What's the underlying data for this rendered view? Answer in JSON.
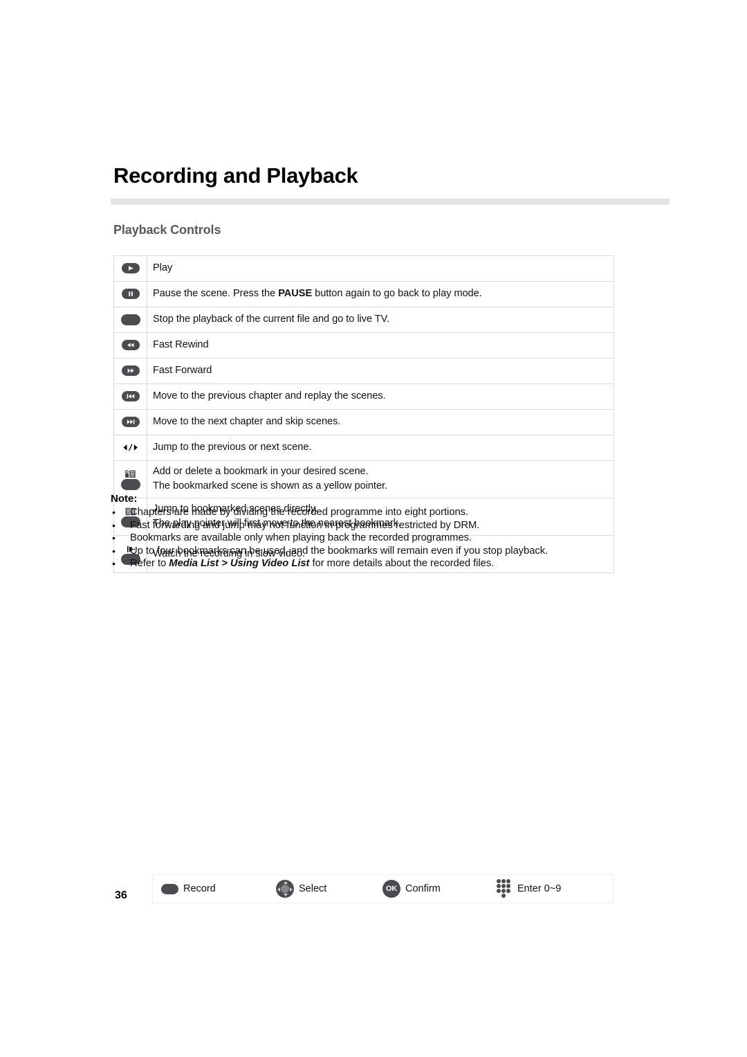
{
  "document": {
    "title": "Recording and Playback",
    "section_heading": "Playback Controls",
    "page_number": "36"
  },
  "table": {
    "rows": [
      {
        "icon": "play-button-icon",
        "lines": [
          "Play"
        ]
      },
      {
        "icon": "pause-button-icon",
        "lines": [
          "Pause the scene. Press the PAUSE button again to go back to play mode."
        ],
        "bold_token": "PAUSE"
      },
      {
        "icon": "stop-button-icon",
        "lines": [
          "Stop the playback of the current file and go to live TV."
        ]
      },
      {
        "icon": "fast-rewind-button-icon",
        "lines": [
          "Fast Rewind"
        ]
      },
      {
        "icon": "fast-forward-button-icon",
        "lines": [
          "Fast Forward"
        ]
      },
      {
        "icon": "previous-chapter-button-icon",
        "lines": [
          "Move to the previous chapter and replay the scenes."
        ]
      },
      {
        "icon": "next-chapter-button-icon",
        "lines": [
          "Move to the next chapter and skip scenes."
        ]
      },
      {
        "icon": "left-right-arrows-icon",
        "lines": [
          "Jump to the previous or next scene."
        ]
      },
      {
        "icon": "add-bookmark-button-icon",
        "lines": [
          "Add or delete a bookmark in your desired scene.",
          "The bookmarked scene is shown as a yellow pointer."
        ]
      },
      {
        "icon": "bookmark-list-button-icon",
        "lines": [
          "Jump to bookmarked scenes directly.",
          "The play pointer will first move to the nearest bookmark."
        ]
      },
      {
        "icon": "slow-motion-button-icon",
        "lines": [
          "Watch the recording in slow video."
        ]
      }
    ]
  },
  "note": {
    "title": "Note:",
    "bullet": "•",
    "items": [
      {
        "text": "Chapters are made by dividing the recorded programme into eight portions."
      },
      {
        "text": "Fast forwarding and jump may not function in programmes restricted by DRM."
      },
      {
        "text": "Bookmarks are available only when playing back the recorded programmes."
      },
      {
        "text": "Up to four bookmarks can be used, and the bookmarks will remain even if you stop playback."
      },
      {
        "text": "Refer to Media List > Using Video List for more details about the recorded files.",
        "emphasis": "Media List > Using Video List",
        "prefix": "Refer to ",
        "suffix": " for more details about the recorded files."
      }
    ]
  },
  "footer_legend": {
    "items": [
      {
        "icon": "record-button-icon",
        "label": "Record"
      },
      {
        "icon": "dpad-icon",
        "label": "Select"
      },
      {
        "icon": "ok-button-icon",
        "label": "Confirm",
        "glyph": "OK"
      },
      {
        "icon": "number-keypad-icon",
        "label": "Enter 0~9"
      }
    ]
  },
  "colors": {
    "button_gray": "#4b4b50",
    "rule_gray": "#e3e4e3",
    "heading_gray": "#58595b",
    "table_border": "#d9dadb"
  }
}
